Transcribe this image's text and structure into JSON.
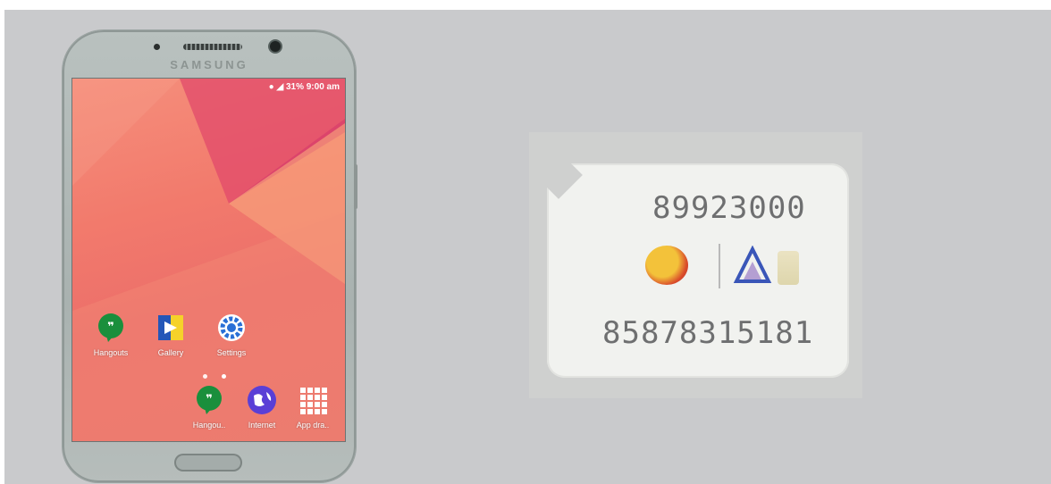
{
  "phone": {
    "brand": "SAMSUNG",
    "status_bar": "31% 9:00 am",
    "apps_row1": [
      {
        "label": "Hangouts",
        "icon": "hangouts-icon"
      },
      {
        "label": "Gallery",
        "icon": "gallery-icon"
      },
      {
        "label": "Settings",
        "icon": "settings-icon"
      }
    ],
    "apps_dock": [
      {
        "label": "Hangou..",
        "icon": "hangouts-icon"
      },
      {
        "label": "Internet",
        "icon": "internet-icon"
      },
      {
        "label": "App dra..",
        "icon": "app-drawer-icon"
      }
    ]
  },
  "sim": {
    "number_top": "89923000",
    "number_bottom": "85878315181",
    "logos": [
      "jazz-logo",
      "triangle-logo"
    ]
  },
  "colors": {
    "backdrop": "#c9cacc",
    "wallpaper": "#f27a6c",
    "hangouts": "#1a8f3c",
    "settings": "#2a6fd6"
  }
}
